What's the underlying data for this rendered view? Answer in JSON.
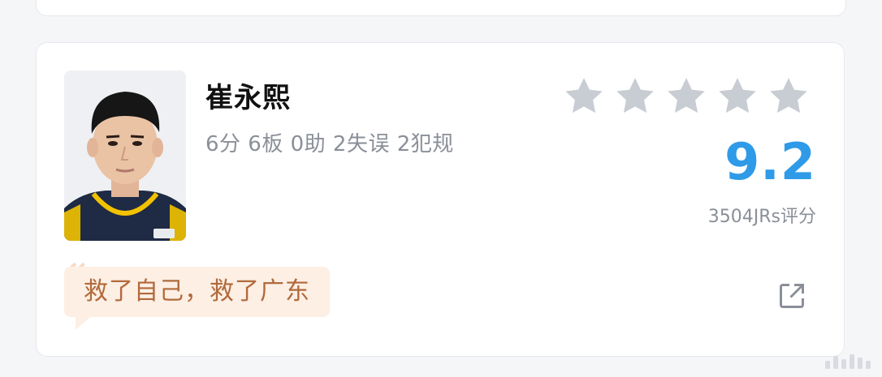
{
  "player": {
    "name": "崔永熙",
    "stat_line": "6分 6板 0助 2失误 2犯规",
    "avatar_icon": "player-headshot"
  },
  "rating": {
    "score": "9.2",
    "votes_text": "3504JRs评分",
    "stars_total": 5,
    "star_color": "#c8ccd3",
    "score_color": "#2f9be8"
  },
  "comment": {
    "text": "救了自己，救了广东",
    "quote_mark": "“",
    "bubble_color": "#fdefe4",
    "text_color": "#b16a3c"
  },
  "actions": {
    "share_icon": "external-share-icon"
  }
}
